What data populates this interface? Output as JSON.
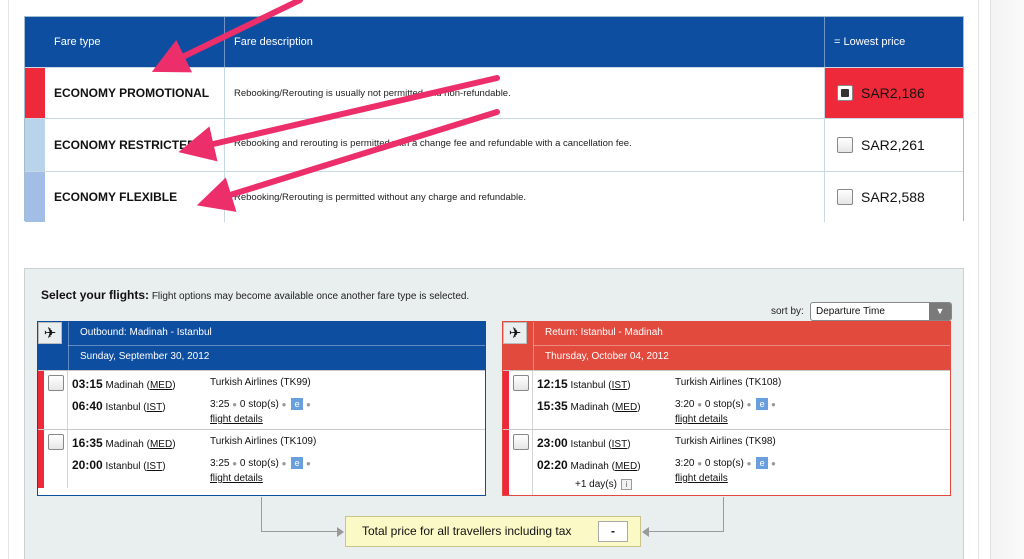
{
  "fare_table": {
    "headers": {
      "fare_type": "Fare type",
      "description": "Fare description",
      "price": "= Lowest price"
    },
    "rows": [
      {
        "name": "ECONOMY PROMOTIONAL",
        "description": "Rebooking/Rerouting is usually not permitted and non-refundable.",
        "price": "SAR2,186",
        "selected": true,
        "strip_color": "#ee2a3a"
      },
      {
        "name": "ECONOMY RESTRICTED",
        "description": "Rebooking and rerouting is permitted with a change fee and refundable with a cancellation fee.",
        "price": "SAR2,261",
        "selected": false,
        "strip_color": "#b9d4ea"
      },
      {
        "name": "ECONOMY FLEXIBLE",
        "description": "Rebooking/Rerouting is permitted without any charge and refundable.",
        "price": "SAR2,588",
        "selected": false,
        "strip_color": "#a2bde6"
      }
    ]
  },
  "flights": {
    "title_bold": "Select your flights:",
    "title_text": "Flight options may become available once another fare type is selected.",
    "sort_label": "sort by:",
    "sort_value": "Departure Time",
    "outbound": {
      "route": "Outbound: Madinah - Istanbul",
      "date": "Sunday, September 30, 2012",
      "items": [
        {
          "dep_time": "03:15",
          "dep_city": "Madinah (",
          "dep_code": "MED",
          "arr_time": "06:40",
          "arr_city": "Istanbul (",
          "arr_code": "IST",
          "airline": "Turkish Airlines (TK99)",
          "duration": "3:25",
          "stops": "0 stop(s)",
          "details": "flight details"
        },
        {
          "dep_time": "16:35",
          "dep_city": "Madinah (",
          "dep_code": "MED",
          "arr_time": "20:00",
          "arr_city": "Istanbul (",
          "arr_code": "IST",
          "airline": "Turkish Airlines (TK109)",
          "duration": "3:25",
          "stops": "0 stop(s)",
          "details": "flight details"
        }
      ]
    },
    "return": {
      "route": "Return: Istanbul - Madinah",
      "date": "Thursday, October 04, 2012",
      "items": [
        {
          "dep_time": "12:15",
          "dep_city": "Istanbul (",
          "dep_code": "IST",
          "arr_time": "15:35",
          "arr_city": "Madinah (",
          "arr_code": "MED",
          "airline": "Turkish Airlines (TK108)",
          "duration": "3:20",
          "stops": "0 stop(s)",
          "details": "flight details"
        },
        {
          "dep_time": "23:00",
          "dep_city": "Istanbul (",
          "dep_code": "IST",
          "arr_time": "02:20",
          "arr_city": "Madinah (",
          "arr_code": "MED",
          "airline": "Turkish Airlines (TK98)",
          "duration": "3:20",
          "stops": "0 stop(s)",
          "next_day": "+1 day(s)",
          "details": "flight details"
        }
      ]
    },
    "e_badge": "e",
    "close_paren": ")",
    "info_icon": "i"
  },
  "total": {
    "label": "Total price for all travellers including tax",
    "amount": "-"
  },
  "colors": {
    "header_blue": "#0e4ea0",
    "selected_red": "#ee2a3a",
    "return_red": "#e24a3e",
    "annotation_pink": "#ec2f6b"
  },
  "icons": {
    "plane": "airplane-icon",
    "dropdown": "chevron-down-icon"
  }
}
